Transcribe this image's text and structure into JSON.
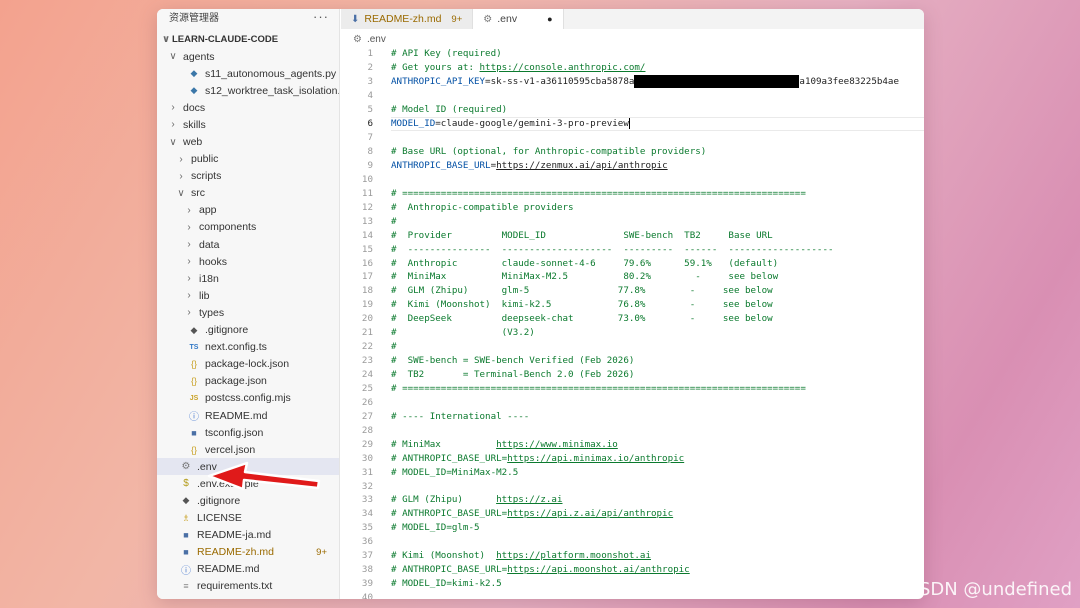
{
  "explorer": {
    "title": "资源管理器",
    "more": "···",
    "project": "LEARN-CLAUDE-CODE"
  },
  "tree": [
    {
      "indent": 0,
      "chev": "∨",
      "icon": "",
      "label": "agents"
    },
    {
      "indent": 1,
      "chev": "",
      "icon": "py",
      "label": "s11_autonomous_agents.py"
    },
    {
      "indent": 1,
      "chev": "",
      "icon": "py",
      "label": "s12_worktree_task_isolation.py"
    },
    {
      "indent": 0,
      "chev": "›",
      "icon": "",
      "label": "docs"
    },
    {
      "indent": 0,
      "chev": "›",
      "icon": "",
      "label": "skills"
    },
    {
      "indent": 0,
      "chev": "∨",
      "icon": "",
      "label": "web"
    },
    {
      "indent": 1,
      "chev": "›",
      "icon": "",
      "label": "public"
    },
    {
      "indent": 1,
      "chev": "›",
      "icon": "",
      "label": "scripts"
    },
    {
      "indent": 1,
      "chev": "∨",
      "icon": "",
      "label": "src"
    },
    {
      "indent": 2,
      "chev": "›",
      "icon": "",
      "label": "app"
    },
    {
      "indent": 2,
      "chev": "›",
      "icon": "",
      "label": "components"
    },
    {
      "indent": 2,
      "chev": "›",
      "icon": "",
      "label": "data"
    },
    {
      "indent": 2,
      "chev": "›",
      "icon": "",
      "label": "hooks"
    },
    {
      "indent": 2,
      "chev": "›",
      "icon": "",
      "label": "i18n"
    },
    {
      "indent": 2,
      "chev": "›",
      "icon": "",
      "label": "lib"
    },
    {
      "indent": 2,
      "chev": "›",
      "icon": "",
      "label": "types"
    },
    {
      "indent": 1,
      "chev": "",
      "icon": "git",
      "label": ".gitignore"
    },
    {
      "indent": 1,
      "chev": "",
      "icon": "ts",
      "label": "next.config.ts"
    },
    {
      "indent": 1,
      "chev": "",
      "icon": "json",
      "label": "package-lock.json"
    },
    {
      "indent": 1,
      "chev": "",
      "icon": "json",
      "label": "package.json"
    },
    {
      "indent": 1,
      "chev": "",
      "icon": "js",
      "label": "postcss.config.mjs"
    },
    {
      "indent": 1,
      "chev": "",
      "icon": "info",
      "label": "README.md"
    },
    {
      "indent": 1,
      "chev": "",
      "icon": "md",
      "label": "tsconfig.json"
    },
    {
      "indent": 1,
      "chev": "",
      "icon": "json",
      "label": "vercel.json"
    },
    {
      "indent": 0,
      "chev": "",
      "icon": "gear",
      "label": ".env",
      "selected": true
    },
    {
      "indent": 0,
      "chev": "",
      "icon": "dollar",
      "label": ".env.example"
    },
    {
      "indent": 0,
      "chev": "",
      "icon": "git",
      "label": ".gitignore"
    },
    {
      "indent": 0,
      "chev": "",
      "icon": "lic",
      "label": "LICENSE"
    },
    {
      "indent": 0,
      "chev": "",
      "icon": "md",
      "label": "README-ja.md"
    },
    {
      "indent": 0,
      "chev": "",
      "icon": "md",
      "label": "README-zh.md",
      "modified": true,
      "badge": "9+"
    },
    {
      "indent": 0,
      "chev": "",
      "icon": "info",
      "label": "README.md"
    },
    {
      "indent": 0,
      "chev": "",
      "icon": "txt",
      "label": "requirements.txt"
    }
  ],
  "tabs": [
    {
      "icon": "md",
      "label": "README-zh.md",
      "badge": "9+",
      "active": false,
      "modified": true
    },
    {
      "icon": "gear",
      "label": ".env",
      "badge": "",
      "active": true,
      "dirty": "●"
    }
  ],
  "breadcrumb": ".env",
  "editor": {
    "current_line": 6,
    "lines": [
      {
        "n": 1,
        "parts": [
          [
            "c",
            "# API Key (required)"
          ]
        ]
      },
      {
        "n": 2,
        "parts": [
          [
            "c",
            "# Get yours at: "
          ],
          [
            "cu",
            "https://console.anthropic.com/"
          ]
        ]
      },
      {
        "n": 3,
        "parts": [
          [
            "k",
            "ANTHROPIC_API_KEY"
          ],
          [
            "t",
            "=sk-ss-v1-a36110595cba5878a"
          ],
          [
            "redact",
            ""
          ],
          [
            "t",
            "a109a3fee83225b4ae"
          ]
        ]
      },
      {
        "n": 4,
        "parts": []
      },
      {
        "n": 5,
        "parts": [
          [
            "c",
            "# Model ID (required)"
          ]
        ]
      },
      {
        "n": 6,
        "parts": [
          [
            "k",
            "MODEL_ID"
          ],
          [
            "t",
            "=claude-google/gemini-3-pro-preview"
          ],
          [
            "cursor",
            ""
          ]
        ]
      },
      {
        "n": 7,
        "parts": []
      },
      {
        "n": 8,
        "parts": [
          [
            "c",
            "# Base URL (optional, for Anthropic-compatible providers)"
          ]
        ]
      },
      {
        "n": 9,
        "parts": [
          [
            "k",
            "ANTHROPIC_BASE_URL"
          ],
          [
            "t",
            "="
          ],
          [
            "u",
            "https://zenmux.ai/api/anthropic"
          ]
        ]
      },
      {
        "n": 10,
        "parts": []
      },
      {
        "n": 11,
        "parts": [
          [
            "c",
            "# ========================================================================="
          ]
        ]
      },
      {
        "n": 12,
        "parts": [
          [
            "c",
            "#  Anthropic-compatible providers"
          ]
        ]
      },
      {
        "n": 13,
        "parts": [
          [
            "c",
            "#"
          ]
        ]
      },
      {
        "n": 14,
        "parts": [
          [
            "c",
            "#  Provider         MODEL_ID              SWE-bench  TB2     Base URL"
          ]
        ]
      },
      {
        "n": 15,
        "parts": [
          [
            "c",
            "#  ---------------  --------------------  ---------  ------  -------------------"
          ]
        ]
      },
      {
        "n": 16,
        "parts": [
          [
            "c",
            "#  Anthropic        claude-sonnet-4-6     79.6%      59.1%   (default)"
          ]
        ]
      },
      {
        "n": 17,
        "parts": [
          [
            "c",
            "#  MiniMax          MiniMax-M2.5          80.2%        -     see below"
          ]
        ]
      },
      {
        "n": 18,
        "parts": [
          [
            "c",
            "#  GLM (Zhipu)      glm-5                77.8%        -     see below"
          ]
        ]
      },
      {
        "n": 19,
        "parts": [
          [
            "c",
            "#  Kimi (Moonshot)  kimi-k2.5            76.8%        -     see below"
          ]
        ]
      },
      {
        "n": 20,
        "parts": [
          [
            "c",
            "#  DeepSeek         deepseek-chat        73.0%        -     see below"
          ]
        ]
      },
      {
        "n": 21,
        "parts": [
          [
            "c",
            "#                   (V3.2)"
          ]
        ]
      },
      {
        "n": 22,
        "parts": [
          [
            "c",
            "#"
          ]
        ]
      },
      {
        "n": 23,
        "parts": [
          [
            "c",
            "#  SWE-bench = SWE-bench Verified (Feb 2026)"
          ]
        ]
      },
      {
        "n": 24,
        "parts": [
          [
            "c",
            "#  TB2       = Terminal-Bench 2.0 (Feb 2026)"
          ]
        ]
      },
      {
        "n": 25,
        "parts": [
          [
            "c",
            "# ========================================================================="
          ]
        ]
      },
      {
        "n": 26,
        "parts": []
      },
      {
        "n": 27,
        "parts": [
          [
            "c",
            "# ---- International ----"
          ]
        ]
      },
      {
        "n": 28,
        "parts": []
      },
      {
        "n": 29,
        "parts": [
          [
            "c",
            "# MiniMax          "
          ],
          [
            "cu",
            "https://www.minimax.io"
          ]
        ]
      },
      {
        "n": 30,
        "parts": [
          [
            "c",
            "# ANTHROPIC_BASE_URL="
          ],
          [
            "cu",
            "https://api.minimax.io/anthropic"
          ]
        ]
      },
      {
        "n": 31,
        "parts": [
          [
            "c",
            "# MODEL_ID=MiniMax-M2.5"
          ]
        ]
      },
      {
        "n": 32,
        "parts": []
      },
      {
        "n": 33,
        "parts": [
          [
            "c",
            "# GLM (Zhipu)      "
          ],
          [
            "cu",
            "https://z.ai"
          ]
        ]
      },
      {
        "n": 34,
        "parts": [
          [
            "c",
            "# ANTHROPIC_BASE_URL="
          ],
          [
            "cu",
            "https://api.z.ai/api/anthropic"
          ]
        ]
      },
      {
        "n": 35,
        "parts": [
          [
            "c",
            "# MODEL_ID=glm-5"
          ]
        ]
      },
      {
        "n": 36,
        "parts": []
      },
      {
        "n": 37,
        "parts": [
          [
            "c",
            "# Kimi (Moonshot)  "
          ],
          [
            "cu",
            "https://platform.moonshot.ai"
          ]
        ]
      },
      {
        "n": 38,
        "parts": [
          [
            "c",
            "# ANTHROPIC_BASE_URL="
          ],
          [
            "cu",
            "https://api.moonshot.ai/anthropic"
          ]
        ]
      },
      {
        "n": 39,
        "parts": [
          [
            "c",
            "# MODEL_ID=kimi-k2.5"
          ]
        ]
      },
      {
        "n": 40,
        "parts": []
      }
    ]
  },
  "watermark": "CSDN @undefined",
  "colors": {
    "comment": "#0b7a2e",
    "key": "#0451a5",
    "modified": "#9a6a00",
    "arrow": "#e01a1a"
  }
}
